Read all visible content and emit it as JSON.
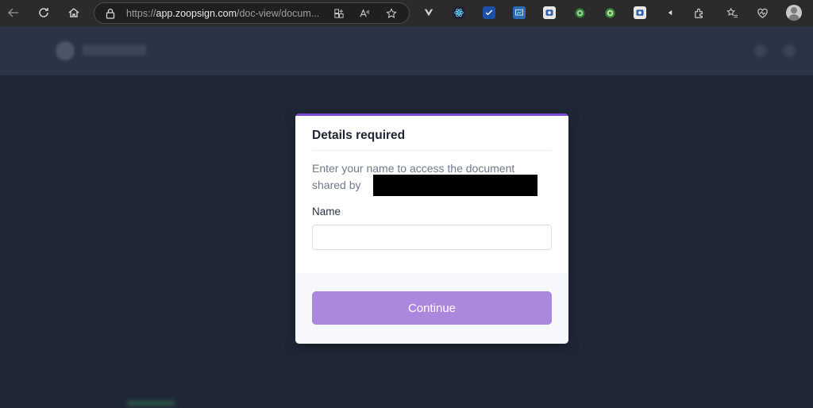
{
  "browser": {
    "url_scheme": "https://",
    "url_host": "app.zoopsign.com",
    "url_path": "/doc-view/docum..."
  },
  "colors": {
    "accent": "#7c4dd6",
    "button": "#ab87de",
    "backdrop": "#1f2737"
  },
  "modal": {
    "title": "Details required",
    "description": "Enter your name to access the document shared by",
    "name_label": "Name",
    "name_value": "",
    "name_placeholder": "",
    "continue_label": "Continue"
  }
}
